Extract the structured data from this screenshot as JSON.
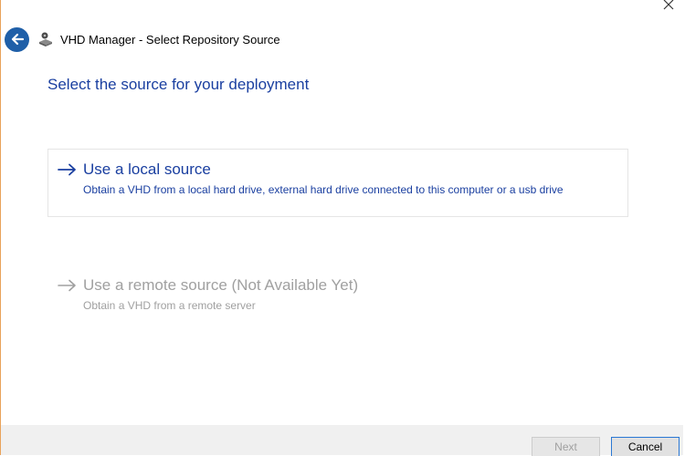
{
  "window": {
    "title": "VHD Manager - Select Repository Source",
    "close_icon": "close-icon",
    "back_icon": "back-arrow-icon",
    "app_icon": "vhd-manager-icon"
  },
  "heading": "Select the source for your deployment",
  "options": [
    {
      "title": "Use a local source",
      "description": "Obtain a VHD from a local hard drive, external hard drive connected to this computer or a usb drive",
      "enabled": true,
      "icon": "arrow-right-icon"
    },
    {
      "title": "Use a remote source (Not Available Yet)",
      "description": "Obtain a VHD from a remote server",
      "enabled": false,
      "icon": "arrow-right-icon"
    }
  ],
  "footer": {
    "next_label": "Next",
    "cancel_label": "Cancel"
  },
  "colors": {
    "accent": "#1a3fa0",
    "disabled": "#a0a0a0",
    "back_button": "#1f5fa8",
    "window_border": "#e8a25a"
  }
}
